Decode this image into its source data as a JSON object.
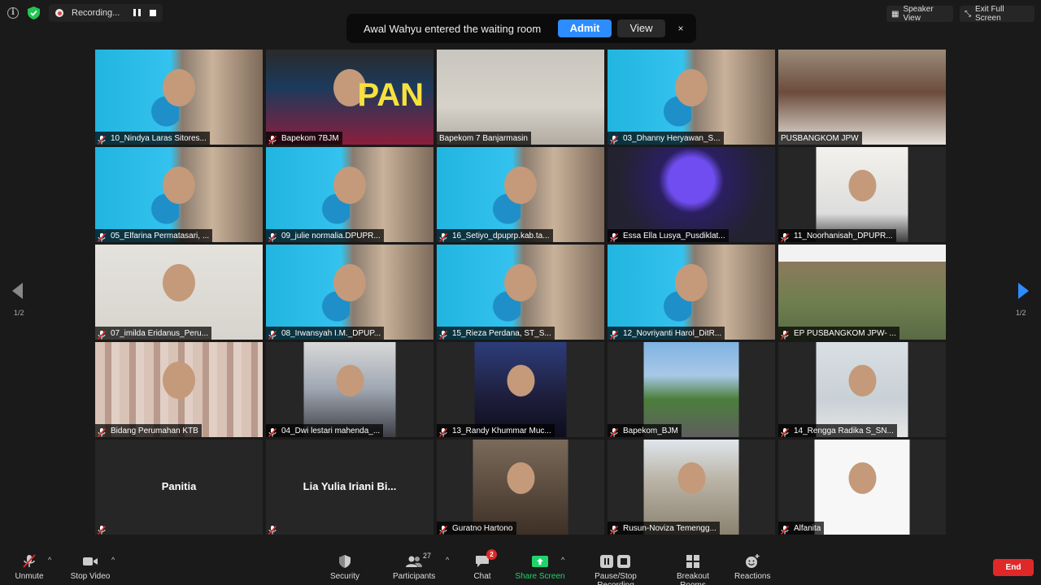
{
  "status": {
    "recording_label": "Recording..."
  },
  "banner": {
    "message": "Awal Wahyu entered the waiting room",
    "admit_label": "Admit",
    "view_label": "View",
    "close_label": "×"
  },
  "top_right": {
    "speaker_view_label": "Speaker View",
    "full_screen_label": "Exit Full Screen"
  },
  "pagination": {
    "left_label": "1/2",
    "right_label": "1/2"
  },
  "participants": [
    {
      "name": "10_Nindya Laras Sitores...",
      "video": "slide",
      "muted": true
    },
    {
      "name": "Bapekom 7BJM",
      "video": "hoodie",
      "muted": true
    },
    {
      "name": "Bapekom 7 Banjarmasin",
      "video": "stage",
      "muted": false,
      "active": true
    },
    {
      "name": "03_Dhanny Heryawan_S...",
      "video": "slide",
      "muted": true
    },
    {
      "name": "PUSBANGKOM JPW",
      "video": "office",
      "muted": false
    },
    {
      "name": "05_Elfarina Permatasari, ...",
      "video": "slide",
      "muted": true
    },
    {
      "name": "09_julie normalia.DPUPR...",
      "video": "slide",
      "muted": true
    },
    {
      "name": "16_Setiyo_dpuprp.kab.ta...",
      "video": "slide",
      "muted": true
    },
    {
      "name": "Essa Ella Lusya_Pusdiklat...",
      "video": "robot",
      "muted": true
    },
    {
      "name": "11_Noorhanisah_DPUPR...",
      "video": "room",
      "muted": true
    },
    {
      "name": "07_imilda Eridanus_Peru...",
      "video": "cream",
      "muted": true
    },
    {
      "name": "08_Irwansyah I.M._DPUP...",
      "video": "slide",
      "muted": true
    },
    {
      "name": "15_Rieza Perdana, ST_S...",
      "video": "slide",
      "muted": true
    },
    {
      "name": "12_Novriyanti Harol_DitR...",
      "video": "slide",
      "muted": true
    },
    {
      "name": "EP PUSBANGKOM JPW- ...",
      "video": "aerial",
      "muted": true
    },
    {
      "name": "Bidang Perumahan KTB",
      "video": "curtain",
      "muted": true
    },
    {
      "name": "04_Dwi lestari mahenda_...",
      "video": "dim",
      "muted": true
    },
    {
      "name": "13_Randy Khummar Muc...",
      "video": "car",
      "muted": true
    },
    {
      "name": "Bapekom_BJM",
      "video": "gate",
      "muted": true
    },
    {
      "name": "14_Rengga Radika S_SN...",
      "video": "wall",
      "muted": true
    },
    {
      "name": "Panitia",
      "video": "none",
      "muted": true
    },
    {
      "name": "Lia Yulia Iriani Bi...",
      "video": "none",
      "muted": true
    },
    {
      "name": "Guratno Hartono",
      "video": "portrait",
      "muted": true
    },
    {
      "name": "Rusun-Noviza Temengg...",
      "video": "palace",
      "muted": true
    },
    {
      "name": "Alfanita",
      "video": "white",
      "muted": true
    }
  ],
  "toolbar": {
    "unmute_label": "Unmute",
    "stop_video_label": "Stop Video",
    "security_label": "Security",
    "participants_label": "Participants",
    "participants_count": "27",
    "chat_label": "Chat",
    "chat_badge": "2",
    "share_screen_label": "Share Screen",
    "recording_label": "Pause/Stop Recording",
    "breakout_label": "Breakout Rooms",
    "reactions_label": "Reactions",
    "end_label": "End"
  },
  "colors": {
    "accent_blue": "#2d8cff",
    "share_green": "#20d36b",
    "end_red": "#e02828",
    "active_speaker": "#c8e341"
  }
}
